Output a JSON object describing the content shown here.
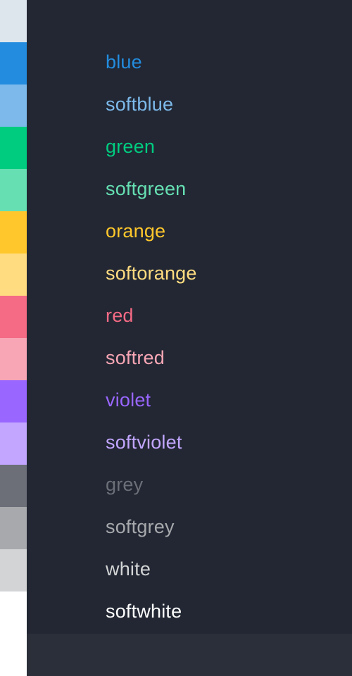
{
  "swatches": [
    {
      "name": "top",
      "color": "#DDE6EC"
    },
    {
      "name": "blue",
      "color": "#238CDF"
    },
    {
      "name": "softblue",
      "color": "#7DBAEB"
    },
    {
      "name": "green",
      "color": "#00CC80"
    },
    {
      "name": "softgreen",
      "color": "#66E0B3"
    },
    {
      "name": "orange",
      "color": "#FFC72C"
    },
    {
      "name": "softorange",
      "color": "#FFDC80"
    },
    {
      "name": "red",
      "color": "#F56A85"
    },
    {
      "name": "softred",
      "color": "#F8A6B5"
    },
    {
      "name": "violet",
      "color": "#9966FF"
    },
    {
      "name": "softviolet",
      "color": "#C2A6FF"
    },
    {
      "name": "grey",
      "color": "#6C6F77"
    },
    {
      "name": "softgrey",
      "color": "#A7A9AD"
    },
    {
      "name": "white",
      "color": "#D3D4D5"
    },
    {
      "name": "softwhite",
      "color": "#FFFFFF"
    },
    {
      "name": "bottom",
      "color": "#FFFFFF"
    }
  ],
  "colors": [
    {
      "label": "blue",
      "color": "#238CDF"
    },
    {
      "label": "softblue",
      "color": "#7DBAEB"
    },
    {
      "label": "green",
      "color": "#00CC80"
    },
    {
      "label": "softgreen",
      "color": "#66E0B3"
    },
    {
      "label": "orange",
      "color": "#FFC72C"
    },
    {
      "label": "softorange",
      "color": "#FFDC80"
    },
    {
      "label": "red",
      "color": "#F56A85"
    },
    {
      "label": "softred",
      "color": "#F8A6B5"
    },
    {
      "label": "violet",
      "color": "#9966FF"
    },
    {
      "label": "softviolet",
      "color": "#C2A6FF"
    },
    {
      "label": "grey",
      "color": "#6C6F77"
    },
    {
      "label": "softgrey",
      "color": "#A7A9AD"
    },
    {
      "label": "white",
      "color": "#D3D4D5"
    },
    {
      "label": "softwhite",
      "color": "#FFFFFF"
    }
  ],
  "theme": {
    "background": "#222733",
    "footer": "#2A2F3A"
  }
}
